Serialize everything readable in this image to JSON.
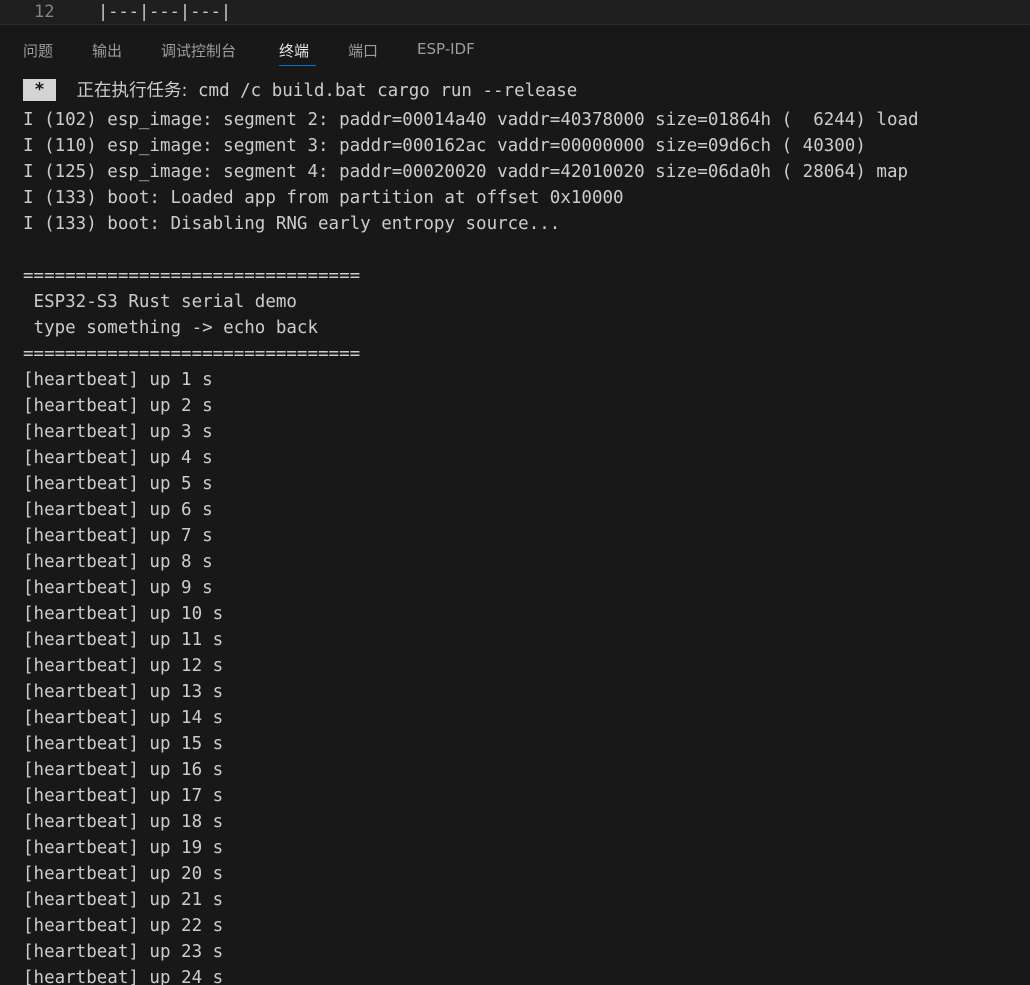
{
  "editor": {
    "line_number": "12",
    "line_text": "|---|---|---|"
  },
  "panel": {
    "tabs": [
      {
        "label": "问题"
      },
      {
        "label": "输出"
      },
      {
        "label": "调试控制台"
      },
      {
        "label": "终端"
      },
      {
        "label": "端口"
      },
      {
        "label": "ESP-IDF"
      }
    ],
    "active_tab": "终端"
  },
  "terminal": {
    "task": {
      "badge": "*",
      "prefix": "正在执行任务:",
      "command": "cmd /c build.bat cargo run --release"
    },
    "lines": [
      "I (102) esp_image: segment 2: paddr=00014a40 vaddr=40378000 size=01864h (  6244) load",
      "I (110) esp_image: segment 3: paddr=000162ac vaddr=00000000 size=09d6ch ( 40300)",
      "I (125) esp_image: segment 4: paddr=00020020 vaddr=42010020 size=06da0h ( 28064) map",
      "I (133) boot: Loaded app from partition at offset 0x10000",
      "I (133) boot: Disabling RNG early entropy source...",
      "",
      "================================",
      " ESP32-S3 Rust serial demo",
      " type something -> echo back",
      "================================",
      "[heartbeat] up 1 s",
      "[heartbeat] up 2 s",
      "[heartbeat] up 3 s",
      "[heartbeat] up 4 s",
      "[heartbeat] up 5 s",
      "[heartbeat] up 6 s",
      "[heartbeat] up 7 s",
      "[heartbeat] up 8 s",
      "[heartbeat] up 9 s",
      "[heartbeat] up 10 s",
      "[heartbeat] up 11 s",
      "[heartbeat] up 12 s",
      "[heartbeat] up 13 s",
      "[heartbeat] up 14 s",
      "[heartbeat] up 15 s",
      "[heartbeat] up 16 s",
      "[heartbeat] up 17 s",
      "[heartbeat] up 18 s",
      "[heartbeat] up 19 s",
      "[heartbeat] up 20 s",
      "[heartbeat] up 21 s",
      "[heartbeat] up 22 s",
      "[heartbeat] up 23 s",
      "[heartbeat] up 24 s"
    ]
  },
  "colors": {
    "background": "#181818",
    "editor_background": "#1f1f1f",
    "text": "#cccccc",
    "active_tab_underline": "#0078d4",
    "task_badge": "#d4d4d4"
  }
}
